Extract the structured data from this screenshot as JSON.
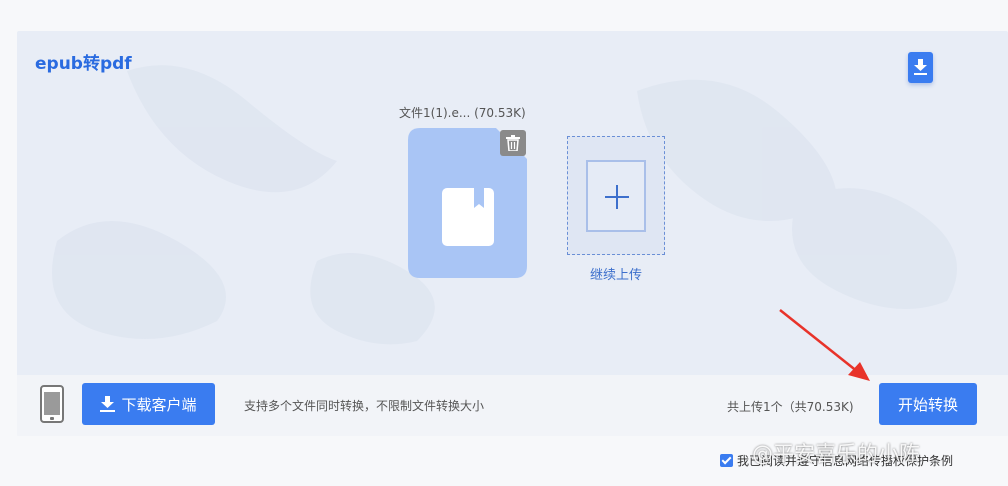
{
  "header": {
    "title": "epub转pdf",
    "download_icon": "download-file-icon"
  },
  "file": {
    "name": "文件1(1).e...",
    "size": "(70.53K)",
    "icon": "book-icon",
    "delete_icon": "trash-icon"
  },
  "upload": {
    "label": "继续上传",
    "icon": "plus-icon"
  },
  "bottom": {
    "phone_icon": "mobile-phone-icon",
    "download_client_label": "下载客户端",
    "support_text": "支持多个文件同时转换，不限制文件转换大小",
    "summary": "共上传1个（共70.53K)",
    "start_label": "开始转换"
  },
  "agreement": {
    "text": "我已阅读并遵守信息网络传播权保护条例",
    "checked": true
  },
  "watermark": "@平安喜乐的小陈",
  "colors": {
    "accent": "#3a7cf0",
    "panel": "#e8edf6",
    "file_card": "#a9c5f5",
    "annotation_arrow": "#e8332a"
  }
}
